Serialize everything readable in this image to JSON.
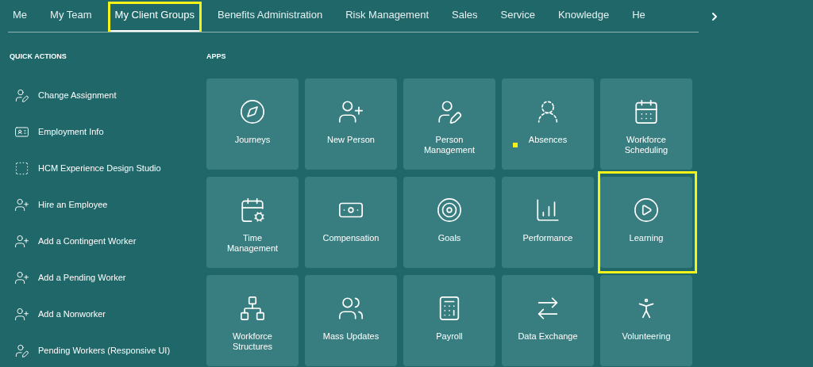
{
  "tabs": [
    {
      "label": "Me",
      "selected": false,
      "highlighted": false
    },
    {
      "label": "My Team",
      "selected": false,
      "highlighted": false
    },
    {
      "label": "My Client Groups",
      "selected": true,
      "highlighted": true
    },
    {
      "label": "Benefits Administration",
      "selected": false,
      "highlighted": false
    },
    {
      "label": "Risk Management",
      "selected": false,
      "highlighted": false
    },
    {
      "label": "Sales",
      "selected": false,
      "highlighted": false
    },
    {
      "label": "Service",
      "selected": false,
      "highlighted": false
    },
    {
      "label": "Knowledge",
      "selected": false,
      "highlighted": false
    },
    {
      "label": "He",
      "selected": false,
      "highlighted": false
    }
  ],
  "quick_actions": {
    "heading": "QUICK ACTIONS",
    "items": [
      {
        "label": "Change Assignment",
        "kind": "edit"
      },
      {
        "label": "Employment Info",
        "kind": "info"
      },
      {
        "label": "HCM Experience Design Studio",
        "kind": "studio"
      },
      {
        "label": "Hire an Employee",
        "kind": "add"
      },
      {
        "label": "Add a Contingent Worker",
        "kind": "add"
      },
      {
        "label": "Add a Pending Worker",
        "kind": "add"
      },
      {
        "label": "Add a Nonworker",
        "kind": "add"
      },
      {
        "label": "Pending Workers (Responsive UI)",
        "kind": "edit"
      }
    ]
  },
  "apps": {
    "heading": "APPS",
    "tiles": [
      {
        "label": "Journeys",
        "highlighted": false,
        "marker": false
      },
      {
        "label": "New Person",
        "highlighted": false,
        "marker": false
      },
      {
        "label": "Person Management",
        "highlighted": false,
        "marker": false
      },
      {
        "label": "Absences",
        "highlighted": false,
        "marker": true
      },
      {
        "label": "Workforce Scheduling",
        "highlighted": false,
        "marker": false
      },
      {
        "label": "Time Management",
        "highlighted": false,
        "marker": false
      },
      {
        "label": "Compensation",
        "highlighted": false,
        "marker": false
      },
      {
        "label": "Goals",
        "highlighted": false,
        "marker": false
      },
      {
        "label": "Performance",
        "highlighted": false,
        "marker": false
      },
      {
        "label": "Learning",
        "highlighted": true,
        "marker": false
      },
      {
        "label": "Workforce Structures",
        "highlighted": false,
        "marker": false
      },
      {
        "label": "Mass Updates",
        "highlighted": false,
        "marker": false
      },
      {
        "label": "Payroll",
        "highlighted": false,
        "marker": false
      },
      {
        "label": "Data Exchange",
        "highlighted": false,
        "marker": false
      },
      {
        "label": "Volunteering",
        "highlighted": false,
        "marker": false
      }
    ]
  }
}
